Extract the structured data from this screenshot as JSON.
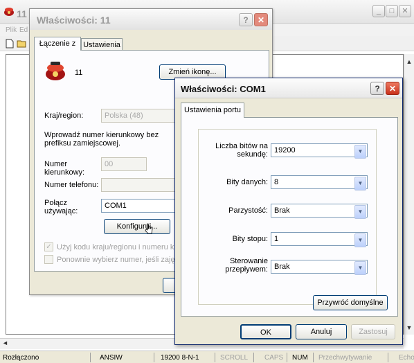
{
  "main_window": {
    "title": "11",
    "menu": [
      "Plik",
      "Ed"
    ],
    "statusbar": {
      "connection": "Rozłączono",
      "emulation": "ANSIW",
      "settings": "19200 8-N-1",
      "scroll": "SCROLL",
      "caps": "CAPS",
      "num": "NUM",
      "capture": "Przechwytywanie",
      "echo": "Echo"
    }
  },
  "dialog_properties": {
    "title": "Właściwości: 11",
    "tabs": [
      "Łączenie z",
      "Ustawienia"
    ],
    "active_tab": "Łączenie z",
    "connection_name": "11",
    "change_icon_button": "Zmień ikonę...",
    "country_label": "Kraj/region:",
    "country_value": "Polska (48)",
    "instruction": "Wprowadź numer kierunkowy bez prefiksu zamiejscowej.",
    "area_code_label": "Numer kierunkowy:",
    "area_code_value": "00",
    "phone_label": "Numer telefonu:",
    "phone_value": "",
    "connect_using_label": "Połącz używając:",
    "connect_using_value": "COM1",
    "configure_button": "Konfiguruj...",
    "use_country_code_checkbox": "Użyj kodu kraju/regionu i numeru kierunkowego",
    "redial_checkbox": "Ponownie wybierz numer, jeśli zajęte"
  },
  "dialog_com1": {
    "title": "Właściwości: COM1",
    "tab": "Ustawienia portu",
    "fields": [
      {
        "label": "Liczba bitów na sekundę:",
        "value": "19200"
      },
      {
        "label": "Bity danych:",
        "value": "8"
      },
      {
        "label": "Parzystość:",
        "value": "Brak"
      },
      {
        "label": "Bity stopu:",
        "value": "1"
      },
      {
        "label": "Sterowanie przepływem:",
        "value": "Brak"
      }
    ],
    "restore_defaults_button": "Przywróć domyślne",
    "ok_button": "OK",
    "cancel_button": "Anuluj",
    "apply_button": "Zastosuj"
  },
  "colors": {
    "close_button": "#d9432c",
    "dialog_bg": "#ece9d8",
    "button_border": "#003c74"
  }
}
